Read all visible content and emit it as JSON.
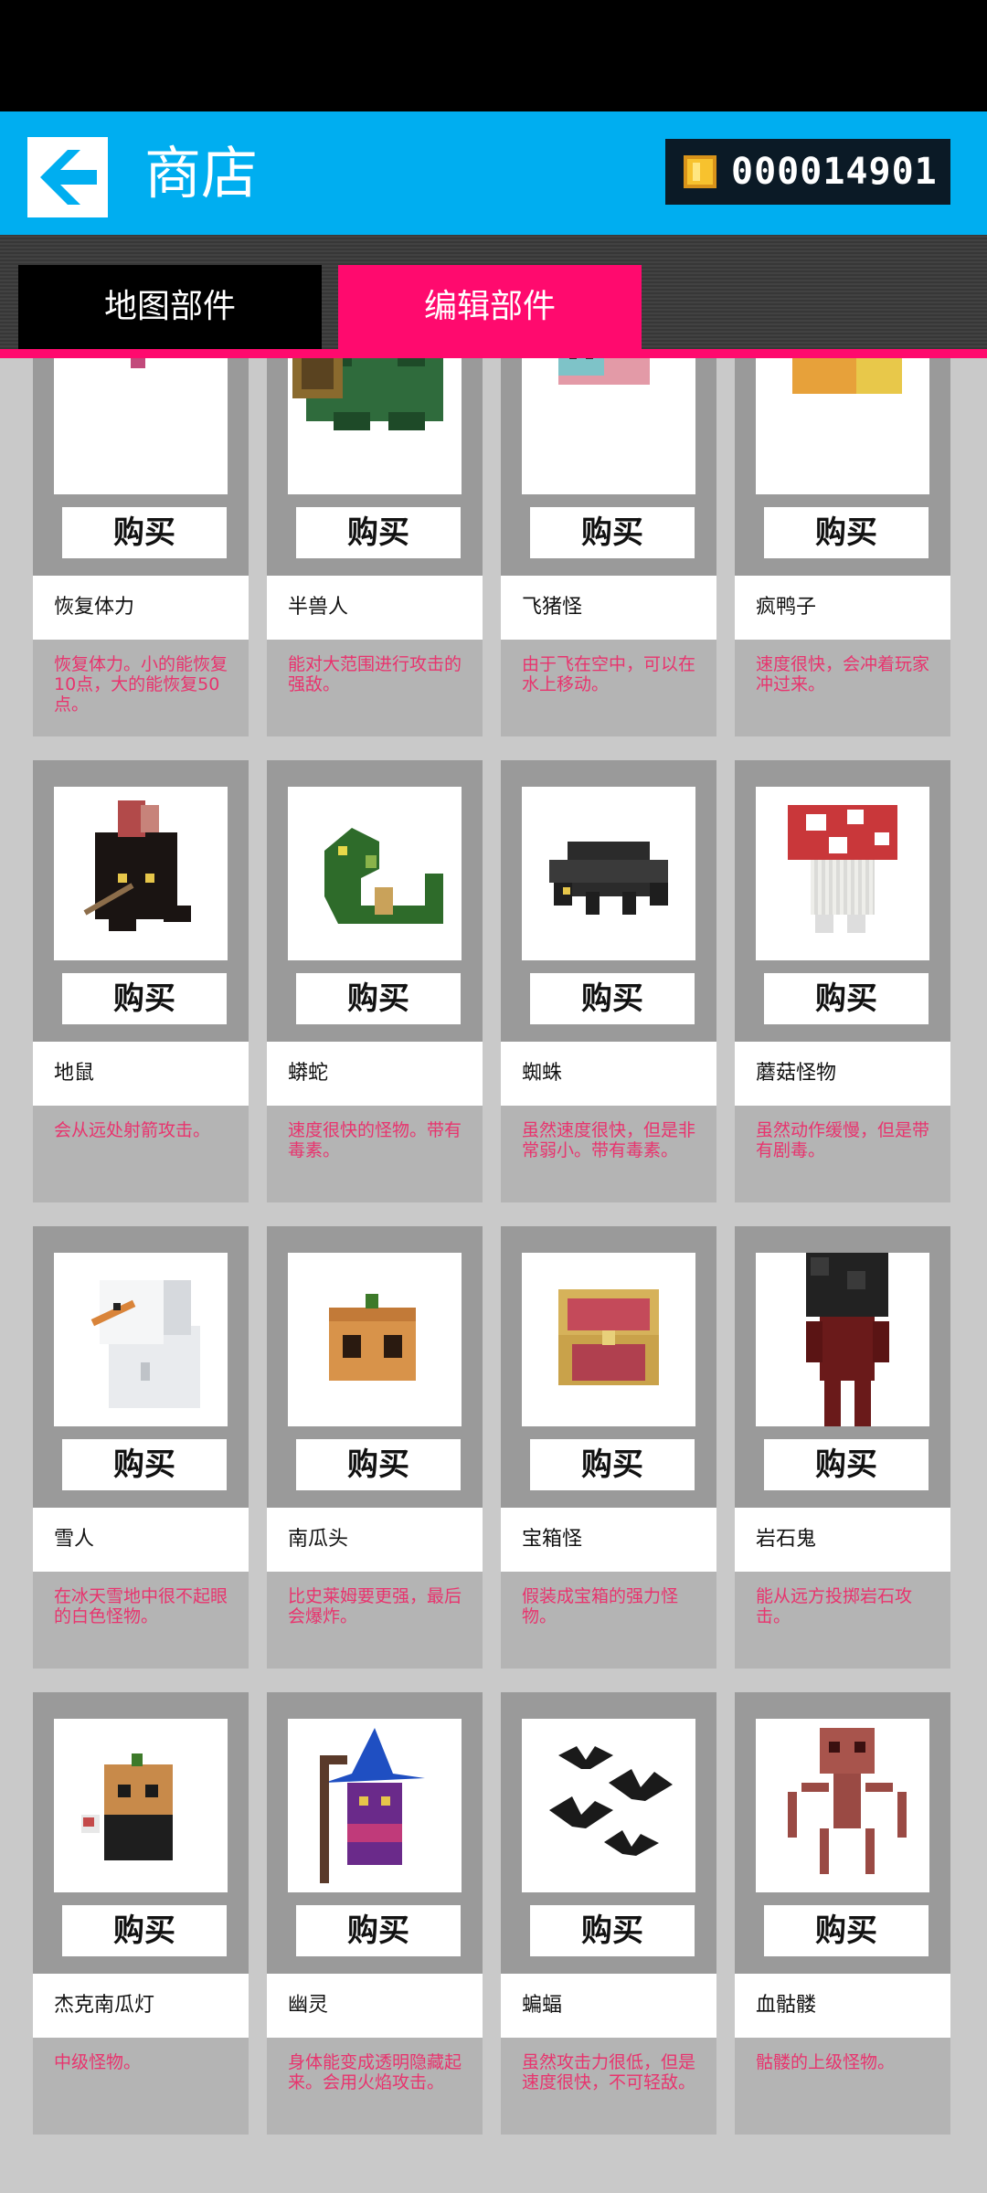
{
  "header": {
    "title": "商店",
    "coins": "000014901"
  },
  "tabs": [
    {
      "label": "地图部件"
    },
    {
      "label": "编辑部件"
    }
  ],
  "buy_label": "购买",
  "items": [
    {
      "name": "恢复体力",
      "desc": "恢复体力。小的能恢复10点，大的能恢复50点。",
      "icon": "pink-heart-icon"
    },
    {
      "name": "半兽人",
      "desc": "能对大范围进行攻击的强敌。",
      "icon": "orc-icon"
    },
    {
      "name": "飞猪怪",
      "desc": "由于飞在空中，可以在水上移动。",
      "icon": "flying-pig-icon"
    },
    {
      "name": "疯鸭子",
      "desc": "速度很快，会冲着玩家冲过来。",
      "icon": "crazy-duck-icon"
    },
    {
      "name": "地鼠",
      "desc": "会从远处射箭攻击。",
      "icon": "mole-archer-icon"
    },
    {
      "name": "蟒蛇",
      "desc": "速度很快的怪物。带有毒素。",
      "icon": "python-icon"
    },
    {
      "name": "蜘蛛",
      "desc": "虽然速度很快，但是非常弱小。带有毒素。",
      "icon": "spider-icon"
    },
    {
      "name": "蘑菇怪物",
      "desc": "虽然动作缓慢，但是带有剧毒。",
      "icon": "mushroom-monster-icon"
    },
    {
      "name": "雪人",
      "desc": "在冰天雪地中很不起眼的白色怪物。",
      "icon": "snowman-icon"
    },
    {
      "name": "南瓜头",
      "desc": "比史莱姆要更强，最后会爆炸。",
      "icon": "pumpkin-head-icon"
    },
    {
      "name": "宝箱怪",
      "desc": "假装成宝箱的强力怪物。",
      "icon": "mimic-chest-icon"
    },
    {
      "name": "岩石鬼",
      "desc": "能从远方投掷岩石攻击。",
      "icon": "rock-ghost-icon"
    },
    {
      "name": "杰克南瓜灯",
      "desc": "中级怪物。",
      "icon": "jack-o-lantern-icon"
    },
    {
      "name": "幽灵",
      "desc": "身体能变成透明隐藏起来。会用火焰攻击。",
      "icon": "wizard-ghost-icon"
    },
    {
      "name": "蝙蝠",
      "desc": "虽然攻击力很低，但是速度很快，不可轻敌。",
      "icon": "bats-icon"
    },
    {
      "name": "血骷髅",
      "desc": "骷髅的上级怪物。",
      "icon": "blood-skeleton-icon"
    }
  ]
}
